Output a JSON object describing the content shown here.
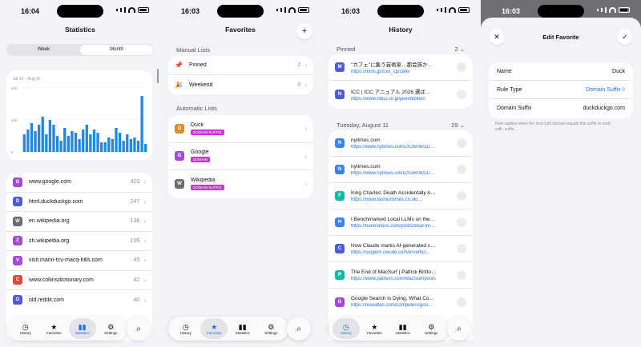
{
  "status": {
    "p1_time": "16:04",
    "p2_time": "16:03",
    "p3_time": "16:03",
    "p4_time": "16:03"
  },
  "colors": {
    "accent": "#1f6feb",
    "chart_bar": "#1f87e5",
    "badge": "#c534d6"
  },
  "statistics": {
    "title": "Statistics",
    "segments": [
      "Week",
      "Month"
    ],
    "selected_segment": "Month",
    "range_label": "Jul 13 – Aug 11",
    "sites": [
      {
        "letter": "G",
        "name": "www.google.com",
        "count": "420",
        "color": "#a24cd6"
      },
      {
        "letter": "D",
        "name": "html.duckduckgo.com",
        "count": "247",
        "color": "#4e5ad6"
      },
      {
        "letter": "W",
        "name": "en.wikipedia.org",
        "count": "138",
        "color": "#6b6b72"
      },
      {
        "letter": "Z",
        "name": "zh.wikipedia.org",
        "count": "106",
        "color": "#a24cd6"
      },
      {
        "letter": "V",
        "name": "visit.marin-tcv-macq-hills.com",
        "count": "45",
        "color": "#a24cd6"
      },
      {
        "letter": "C",
        "name": "www.collinsdictionary.com",
        "count": "42",
        "color": "#e0463a"
      },
      {
        "letter": "O",
        "name": "old.reddit.com",
        "count": "40",
        "color": "#4e5ad6"
      }
    ]
  },
  "chart_data": {
    "type": "bar",
    "title": "",
    "xlabel": "",
    "ylabel": "",
    "y_ticks": [
      "200",
      "100",
      "0"
    ],
    "ylim": [
      0,
      200
    ],
    "values": [
      55,
      70,
      90,
      65,
      85,
      110,
      55,
      100,
      85,
      50,
      35,
      75,
      50,
      65,
      60,
      40,
      70,
      85,
      55,
      70,
      60,
      30,
      30,
      45,
      40,
      75,
      60,
      35,
      55,
      40,
      45,
      35,
      175,
      25
    ],
    "grid": true
  },
  "favorites": {
    "title": "Favorites",
    "add_label": "+",
    "manual_header": "Manual Lists",
    "manual": [
      {
        "icon": "📌",
        "name": "Pinned",
        "count": "2"
      },
      {
        "icon": "🎉",
        "name": "Weekend",
        "count": "0"
      }
    ],
    "auto_header": "Automatic Lists",
    "auto": [
      {
        "letter": "D",
        "name": "Duck",
        "badge": "DOMAIN-SUFFIX",
        "color": "#e08a2a"
      },
      {
        "letter": "G",
        "name": "Google",
        "badge": "DOMAIN",
        "color": "#a24cd6"
      },
      {
        "letter": "W",
        "name": "Wikipedia",
        "badge": "DOMAIN-SUFFIX",
        "color": "#6b6b72"
      }
    ]
  },
  "history": {
    "title": "History",
    "pinned_header": "Pinned",
    "pinned_count": "2",
    "pinned": [
      {
        "title": "\"カフェ\"に集う芸術家…都会族か…",
        "url": "https://mimi.jp/s/xx_cp/cafe/",
        "color": "#4e5ad6",
        "letter": "M"
      },
      {
        "title": "ICC | ICC アニュアル 2026 選ば…",
        "url": "https://www.ntticc.or.jp/ja/exhibition",
        "color": "#4e5ad6",
        "letter": "N"
      }
    ],
    "day_header": "Tuesday, August 11",
    "day_count": "29",
    "items": [
      {
        "title": "nytimes.com",
        "url": "https://www.nytimes.com/2026/08/11/…",
        "color": "#3b82f6",
        "letter": "N"
      },
      {
        "title": "nytimes.com",
        "url": "https://www.nytimes.com/2026/08/11/…",
        "color": "#3b82f6",
        "letter": "N"
      },
      {
        "title": "King Charles' Death Accidentally A…",
        "url": "https://www.fashiontimes.co.uk/…",
        "color": "#14b8a6",
        "letter": "F"
      },
      {
        "title": "I Benchmarked Local LLMs on the…",
        "url": "https://hannonous.com/posts/local-lm…",
        "color": "#3b82f6",
        "letter": "H"
      },
      {
        "title": "How Claude marks AI-generated c…",
        "url": "https://support.claude.com/en/articl…",
        "color": "#4e5ad6",
        "letter": "C"
      },
      {
        "title": "The End of MacSurf | Patrick Britto…",
        "url": "https://www.patreon.com/MacSurf/posts",
        "color": "#14b8a6",
        "letter": "P"
      },
      {
        "title": "Google Search Is Dying, What Co…",
        "url": "https://newatlas.com/computers/goo…",
        "color": "#a24cd6",
        "letter": "G"
      }
    ]
  },
  "edit": {
    "title": "Edit Favorite",
    "fields": [
      {
        "label": "Name",
        "value": "Duck"
      },
      {
        "label": "Rule Type",
        "value": "Domain Suffix ◊"
      },
      {
        "label": "Domain Suffix",
        "value": "duckduckgo.com"
      }
    ],
    "hint": "Rule applies when the host (url) domain equals this suffix or ends with .suffix."
  },
  "tabs": [
    "History",
    "Favorites",
    "Statistics",
    "Settings"
  ],
  "tab_icons": [
    "clock-icon",
    "star-icon",
    "chart-icon",
    "gear-icon"
  ]
}
